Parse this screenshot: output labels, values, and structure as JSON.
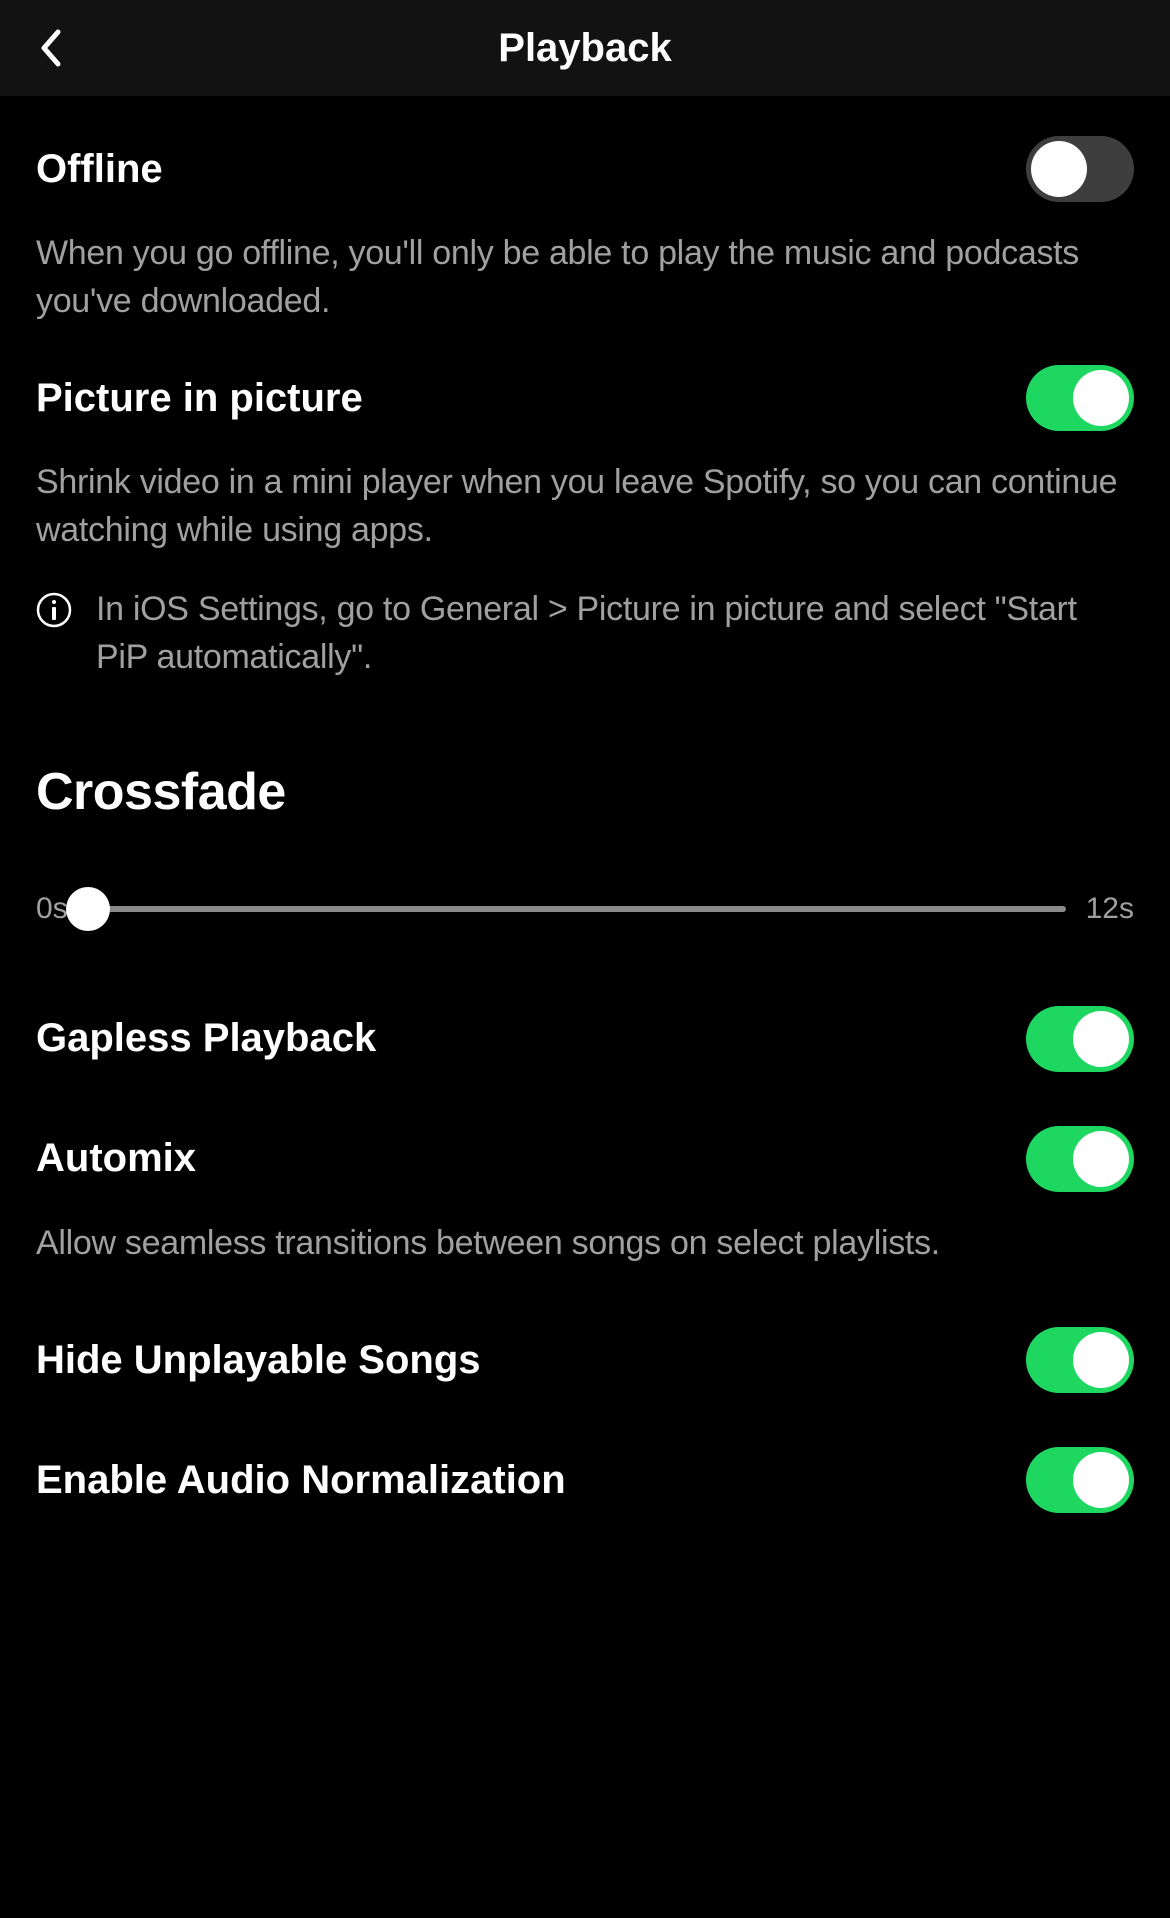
{
  "header": {
    "title": "Playback"
  },
  "offline": {
    "title": "Offline",
    "description": "When you go offline, you'll only be able to play the music and podcasts you've downloaded.",
    "enabled": false
  },
  "pip": {
    "title": "Picture in picture",
    "description": "Shrink video in a mini player when you leave Spotify, so you can continue watching while using apps.",
    "info": "In iOS Settings, go to General > Picture in picture and select \"Start PiP automatically\".",
    "enabled": true
  },
  "crossfade": {
    "section_title": "Crossfade",
    "min_label": "0s",
    "max_label": "12s",
    "value": 0
  },
  "gapless": {
    "title": "Gapless Playback",
    "enabled": true
  },
  "automix": {
    "title": "Automix",
    "description": "Allow seamless transitions between songs on select playlists.",
    "enabled": true
  },
  "hide_unplayable": {
    "title": "Hide Unplayable Songs",
    "enabled": true
  },
  "normalize": {
    "title": "Enable Audio Normalization",
    "enabled": true
  }
}
